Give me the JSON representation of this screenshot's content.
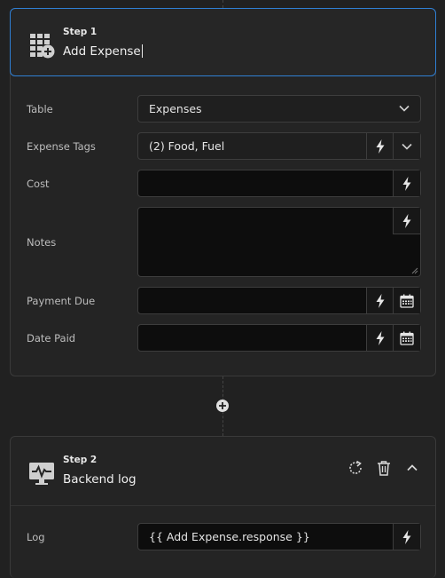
{
  "step1": {
    "number": "Step 1",
    "title": "Add Expense",
    "fields": {
      "table": {
        "label": "Table",
        "value": "Expenses"
      },
      "tags": {
        "label": "Expense Tags",
        "value": "(2) Food, Fuel"
      },
      "cost": {
        "label": "Cost",
        "value": ""
      },
      "notes": {
        "label": "Notes",
        "value": ""
      },
      "payment_due": {
        "label": "Payment Due",
        "value": ""
      },
      "date_paid": {
        "label": "Date Paid",
        "value": ""
      }
    }
  },
  "step2": {
    "number": "Step 2",
    "title": "Backend log",
    "fields": {
      "log": {
        "label": "Log",
        "value": "{{ Add Expense.response }}"
      }
    }
  },
  "colors": {
    "accent": "#2f7fd3",
    "background": "#212121",
    "input": "#0d0d0d"
  },
  "icons": [
    "table-add-icon",
    "lightning-icon",
    "chevron-down-icon",
    "calendar-icon",
    "plus-circle-icon",
    "monitor-pulse-icon",
    "refresh-icon",
    "trash-icon",
    "chevron-up-icon"
  ]
}
